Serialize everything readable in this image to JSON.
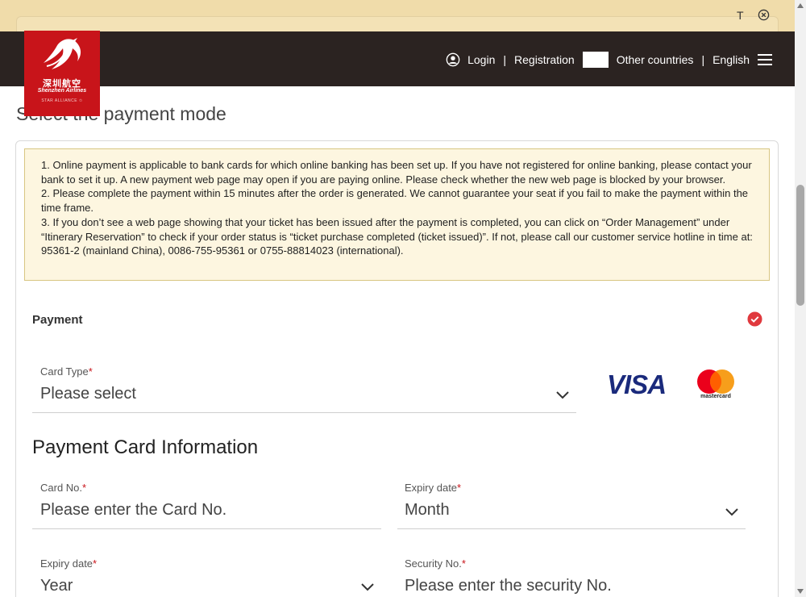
{
  "topbar": {
    "text_size_label": "T"
  },
  "logo": {
    "cn": "深圳航空",
    "en": "Shenzhen Airlines",
    "alliance": "STAR ALLIANCE ✩"
  },
  "nav": {
    "login": "Login",
    "sep": "|",
    "registration": "Registration",
    "other_countries": "Other countries",
    "language": "English"
  },
  "page": {
    "title": "Select the payment mode"
  },
  "notice": {
    "items": [
      "1. Online payment is applicable to bank cards for which online banking has been set up. If you have not registered for online banking, please contact your bank to set it up. A new payment web page may open if you are paying online. Please check whether the new web page is blocked by your browser.",
      "2. Please complete the payment within 15 minutes after the order is generated. We cannot guarantee your seat if you fail to make the payment within the time frame.",
      "3. If you don’t see a web page showing that your ticket has been issued after the payment is completed, you can click on “Order Management” under “Itinerary Reservation” to check if your order status is “ticket purchase completed (ticket issued)”. If not, please call our customer service hotline in time at: 95361-2 (mainland China), 0086-755-95361 or 0755-88814023 (international)."
    ]
  },
  "payment": {
    "label": "Payment",
    "card_type_label": "Card Type",
    "card_type_value": "Please select",
    "visa": "VISA",
    "mastercard": "mastercard"
  },
  "card_info": {
    "title": "Payment Card Information",
    "card_no_label": "Card No.",
    "card_no_placeholder": "Please enter the Card No.",
    "expiry_month_label": "Expiry date",
    "expiry_month_value": "Month",
    "expiry_year_label": "Expiry date",
    "expiry_year_value": "Year",
    "security_label": "Security No.",
    "security_placeholder": "Please enter the security No.",
    "required_mark": "*"
  },
  "colors": {
    "brand_red": "#c8141a",
    "nav_bg": "#2b2321",
    "notice_bg": "#fdf6e0",
    "check_red": "#e0393e"
  }
}
